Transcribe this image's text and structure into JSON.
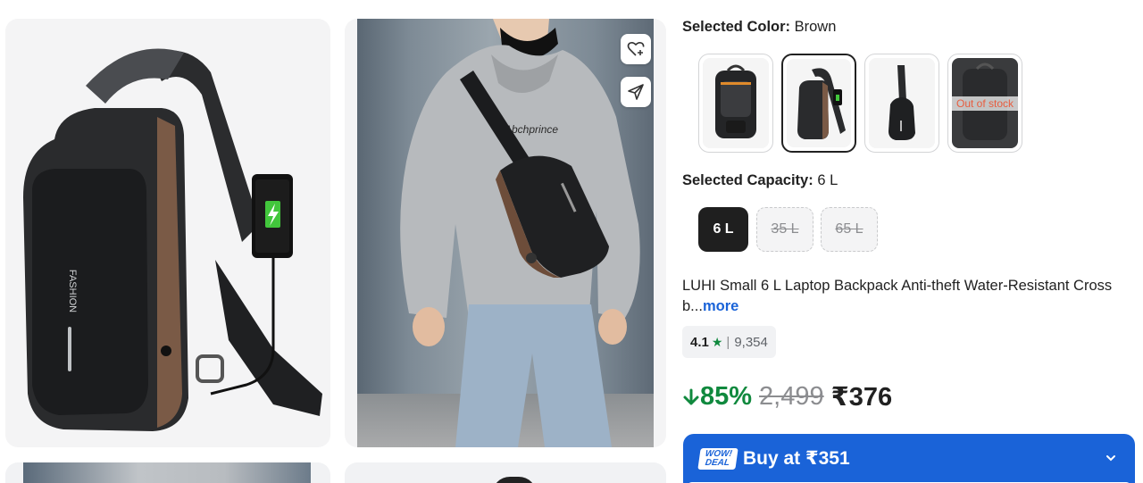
{
  "gallery": {
    "photo1": {
      "alt": "Black and brown sling bag with USB charging port and phone",
      "brand_print": "FASHION"
    },
    "photo2": {
      "alt": "Model wearing grey hoodie with sling bag across chest",
      "hoodie_print": "Abchprince"
    },
    "wishlist_icon": "heart-plus-icon",
    "share_icon": "send-icon"
  },
  "colors": {
    "label": "Selected Color:",
    "value": "Brown",
    "options": [
      {
        "name": "black-laptop-backpack",
        "status": ""
      },
      {
        "name": "brown-sling",
        "status": "selected"
      },
      {
        "name": "black-sling-outline",
        "status": ""
      },
      {
        "name": "grey-backpack",
        "status": "Out of stock"
      }
    ]
  },
  "capacity": {
    "label": "Selected Capacity:",
    "value": "6 L",
    "options": [
      "6 L",
      "35 L",
      "65 L"
    ]
  },
  "product": {
    "title": "LUHI Small 6 L Laptop Backpack Anti-theft Water-Resistant Cross b...",
    "more": "more"
  },
  "rating": {
    "score": "4.1",
    "star": "★",
    "separator": "|",
    "count": "9,354"
  },
  "price": {
    "discount": "85%",
    "mrp": "2,499",
    "final": "₹376"
  },
  "buy": {
    "badge_line1": "WOW!",
    "badge_line2": "DEAL",
    "label": "Buy at ₹351"
  },
  "colors_theme": {
    "accent_blue": "#1a63d8",
    "discount_green": "#10893e",
    "out_of_stock": "#e85d3f"
  }
}
